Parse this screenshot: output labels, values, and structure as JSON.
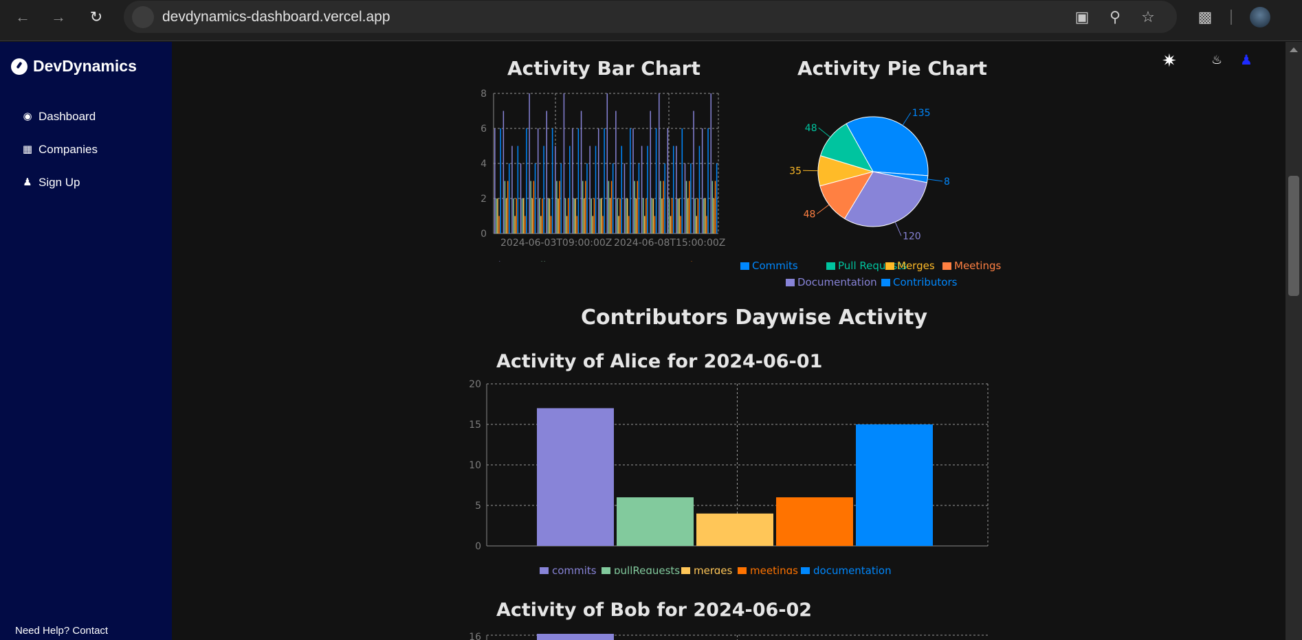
{
  "browser": {
    "url": "devdynamics-dashboard.vercel.app"
  },
  "sidebar": {
    "brand": "DevDynamics",
    "items": [
      {
        "label": "Dashboard",
        "icon": "dashboard-icon"
      },
      {
        "label": "Companies",
        "icon": "building-icon"
      },
      {
        "label": "Sign Up",
        "icon": "user-plus-icon"
      }
    ],
    "help": "Need Help? Contact"
  },
  "header": {
    "icons": [
      "theme-toggle-icon",
      "bell-icon",
      "user-icon"
    ]
  },
  "colors": {
    "commits": "#8884d8",
    "pullRequests": "#82ca9d",
    "merges": "#ffc658",
    "meetings": "#ff7300",
    "documentation": "#0088fe",
    "pie_commits": "#0088fe",
    "pie_pr": "#00c49f",
    "pie_merges": "#ffbb28",
    "pie_meetings": "#ff8042",
    "pie_docs": "#8884d8",
    "pie_contrib": "#0088fe"
  },
  "titles": {
    "bar": "Activity Bar Chart",
    "pie": "Activity Pie Chart",
    "section": "Contributors Daywise Activity",
    "alice": "Activity of Alice for 2024-06-01",
    "bob": "Activity of Bob for 2024-06-02"
  },
  "chart_data": [
    {
      "type": "bar",
      "title": "Activity Bar Chart",
      "x_ticks": [
        "2024-06-03T09:00:00Z",
        "2024-06-08T15:00:00Z"
      ],
      "ylim": [
        0,
        8
      ],
      "y_ticks": [
        0,
        2,
        4,
        6,
        8
      ],
      "grid": true,
      "legend": [
        "commits",
        "pullRequests",
        "merges",
        "meetings",
        "documentation"
      ],
      "legend_placement": "bottom",
      "series_pattern": {
        "commits": [
          6,
          7,
          5,
          4,
          8,
          6,
          7,
          5,
          8,
          6,
          7,
          5,
          6,
          8,
          7,
          4,
          6,
          5,
          7,
          8,
          6,
          5,
          4,
          7,
          6,
          8
        ],
        "pullRequests": [
          2,
          3,
          2,
          2,
          3,
          2,
          2,
          3,
          2,
          2,
          3,
          2,
          2,
          3,
          2,
          2,
          3,
          2,
          2,
          3,
          2,
          2,
          3,
          2,
          2,
          3
        ],
        "merges": [
          2,
          2,
          1,
          2,
          2,
          1,
          2,
          2,
          1,
          2,
          2,
          1,
          2,
          2,
          1,
          2,
          2,
          1,
          2,
          2,
          1,
          2,
          2,
          1,
          2,
          2
        ],
        "meetings": [
          1,
          3,
          2,
          1,
          3,
          2,
          1,
          3,
          2,
          1,
          3,
          2,
          1,
          3,
          2,
          1,
          3,
          2,
          1,
          3,
          2,
          1,
          3,
          2,
          1,
          3
        ],
        "documentation": [
          6,
          4,
          5,
          6,
          4,
          5,
          6,
          4,
          5,
          6,
          4,
          5,
          6,
          4,
          5,
          6,
          4,
          5,
          6,
          4,
          5,
          6,
          4,
          5,
          6,
          4
        ]
      }
    },
    {
      "type": "pie",
      "title": "Activity Pie Chart",
      "slices": [
        {
          "name": "Commits",
          "value": 135,
          "color": "#0088fe"
        },
        {
          "name": "Contributors",
          "value": 8,
          "color": "#0088fe"
        },
        {
          "name": "Documentation",
          "value": 120,
          "color": "#8884d8"
        },
        {
          "name": "Meetings",
          "value": 48,
          "color": "#ff8042"
        },
        {
          "name": "Merges",
          "value": 35,
          "color": "#ffbb28"
        },
        {
          "name": "Pull Requests",
          "value": 48,
          "color": "#00c49f"
        }
      ],
      "legend": [
        {
          "name": "Commits",
          "color": "#0088fe"
        },
        {
          "name": "Pull Requests",
          "color": "#00c49f"
        },
        {
          "name": "Merges",
          "color": "#ffbb28"
        },
        {
          "name": "Meetings",
          "color": "#ff8042"
        },
        {
          "name": "Documentation",
          "color": "#8884d8"
        },
        {
          "name": "Contributors",
          "color": "#0088fe"
        }
      ]
    },
    {
      "type": "bar",
      "title": "Activity of Alice for 2024-06-01",
      "categories": [
        "commits",
        "pullRequests",
        "merges",
        "meetings",
        "documentation"
      ],
      "values": [
        17,
        6,
        4,
        6,
        15
      ],
      "ylim": [
        0,
        20
      ],
      "y_ticks": [
        0,
        5,
        10,
        15,
        20
      ],
      "grid": true,
      "legend_placement": "bottom"
    },
    {
      "type": "bar",
      "title": "Activity of Bob for 2024-06-02",
      "y_ticks": [
        16
      ]
    }
  ]
}
